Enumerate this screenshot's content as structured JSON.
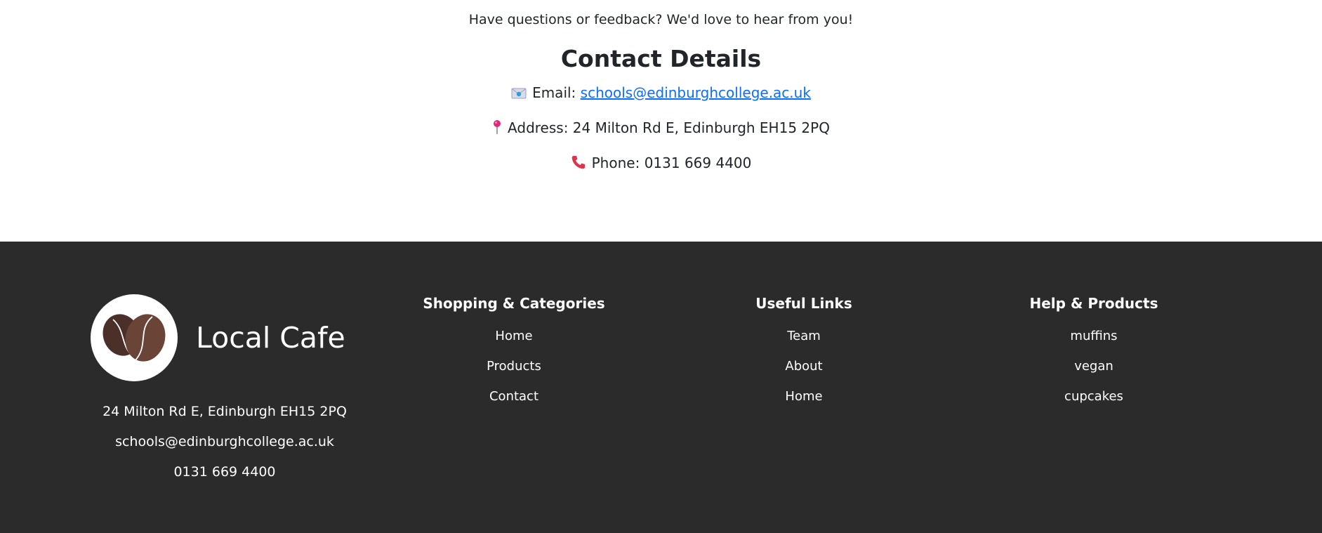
{
  "contact": {
    "intro": "Have questions or feedback? We'd love to hear from you!",
    "heading": "Contact Details",
    "email_label": "Email: ",
    "email": "schools@edinburghcollege.ac.uk",
    "address_label": "Address: ",
    "address": "24 Milton Rd E, Edinburgh EH15 2PQ",
    "phone_label": "Phone: ",
    "phone": "0131 669 4400",
    "icons": {
      "email": "envelope-icon",
      "address": "pushpin-icon",
      "phone": "telephone-icon"
    }
  },
  "footer": {
    "brand_name": "Local Cafe",
    "logo_icon": "coffee-beans-icon",
    "address": "24 Milton Rd E, Edinburgh EH15 2PQ",
    "email": "schools@edinburghcollege.ac.uk",
    "phone": "0131 669 4400",
    "columns": [
      {
        "heading": "Shopping & Categories",
        "links": [
          "Home",
          "Products",
          "Contact"
        ]
      },
      {
        "heading": "Useful Links",
        "links": [
          "Team",
          "About",
          "Home"
        ]
      },
      {
        "heading": "Help & Products",
        "links": [
          "muffins",
          "vegan",
          "cupcakes"
        ]
      }
    ]
  },
  "colors": {
    "footer_bg": "#2b2b2b",
    "link": "#0d6efd",
    "bean_dark": "#4a3029",
    "bean_light": "#6b4438",
    "pin": "#e0287a",
    "phone": "#e0344a"
  }
}
